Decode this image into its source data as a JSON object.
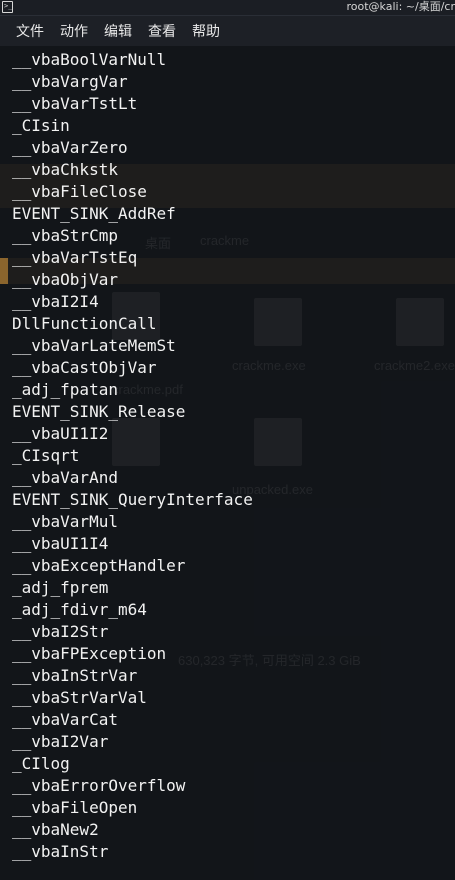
{
  "window": {
    "title": "root@kali: ~/桌面/cr",
    "icon": "terminal-icon"
  },
  "menu": {
    "items": [
      "文件",
      "动作",
      "编辑",
      "查看",
      "帮助"
    ]
  },
  "terminal": {
    "lines": [
      "__vbaBoolVarNull",
      "__vbaVargVar",
      "__vbaVarTstLt",
      "_CIsin",
      "__vbaVarZero",
      "__vbaChkstk",
      "__vbaFileClose",
      "EVENT_SINK_AddRef",
      "__vbaStrCmp",
      "__vbaVarTstEq",
      "__vbaObjVar",
      "__vbaI2I4",
      "DllFunctionCall",
      "__vbaVarLateMemSt",
      "__vbaCastObjVar",
      "_adj_fpatan",
      "EVENT_SINK_Release",
      "__vbaUI1I2",
      "_CIsqrt",
      "__vbaVarAnd",
      "EVENT_SINK_QueryInterface",
      "__vbaVarMul",
      "__vbaUI1I4",
      "__vbaExceptHandler",
      "_adj_fprem",
      "_adj_fdivr_m64",
      "__vbaI2Str",
      "__vbaFPException",
      "__vbaInStrVar",
      "__vbaStrVarVal",
      "__vbaVarCat",
      "__vbaI2Var",
      "_CIlog",
      "__vbaErrorOverflow",
      "__vbaFileOpen",
      "__vbaNew2",
      "__vbaInStr"
    ]
  },
  "background_ghost": {
    "path_crumb_1": "桌面",
    "path_crumb_2": "crackme",
    "files": [
      "crackme.exe",
      "crackme2.exe",
      "crackme.pdf",
      "unpacked.exe"
    ],
    "status": "630,323 字节, 可用空间 2.3 GiB"
  },
  "colors": {
    "terminal_bg": "#12151a",
    "menubar_bg": "#1d2026",
    "text": "#f2f2f2",
    "accent_stripe": "#e6a03c"
  }
}
